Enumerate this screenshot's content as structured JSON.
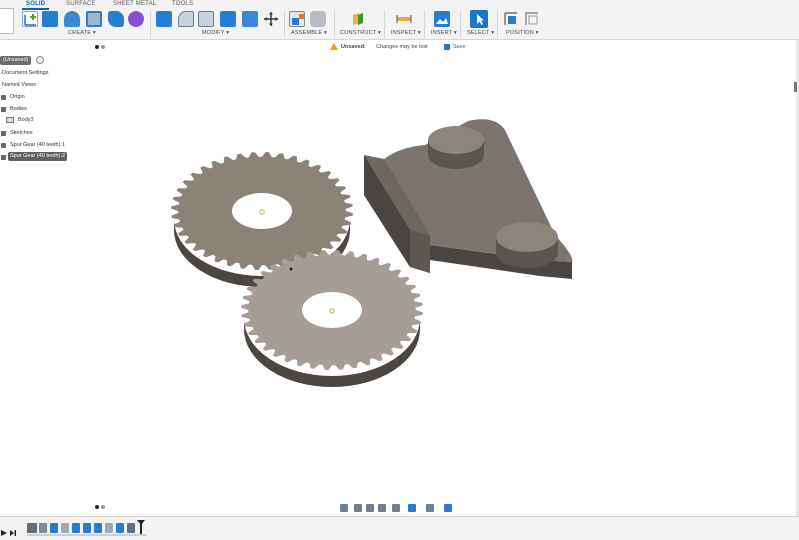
{
  "tabs": [
    "SOLID",
    "SURFACE",
    "SHEET METAL",
    "TOOLS"
  ],
  "groups": {
    "create": "CREATE ▾",
    "modify": "MODIFY ▾",
    "assemble": "ASSEMBLE ▾",
    "construct": "CONSTRUCT ▾",
    "inspect": "INSPECT ▾",
    "insert": "INSERT ▾",
    "select": "SELECT ▾",
    "position": "POSITION ▾"
  },
  "browser": {
    "root": "(Unsaved)",
    "items": [
      "Document Settings",
      "Named Views",
      "Origin",
      "Bodies",
      "Body3",
      "Sketches",
      "Spur Gear (40 teeth):1",
      "Spur Gear (40 teeth):2"
    ]
  },
  "status": {
    "unsaved": "Unsaved:",
    "message": "Changes may be lost",
    "save": "Save"
  },
  "colors": {
    "accent": "#0a64b4",
    "gear_top": "#8b8378",
    "gear_top_light": "#a49e96",
    "gear_side": "#4b4640",
    "bracket_top": "#7b756d",
    "bracket_side": "#4a4540"
  },
  "icons": [
    "sketch-icon",
    "extrude-icon",
    "revolve-icon",
    "sweep-icon",
    "loft-icon",
    "push-pull-icon",
    "fillet-icon",
    "chamfer-icon",
    "shell-icon",
    "combine-icon",
    "move-icon",
    "new-component-icon",
    "joint-icon",
    "offset-plane-icon",
    "measure-icon",
    "insert-image-icon",
    "select-icon",
    "align-icon",
    "play-icon"
  ]
}
